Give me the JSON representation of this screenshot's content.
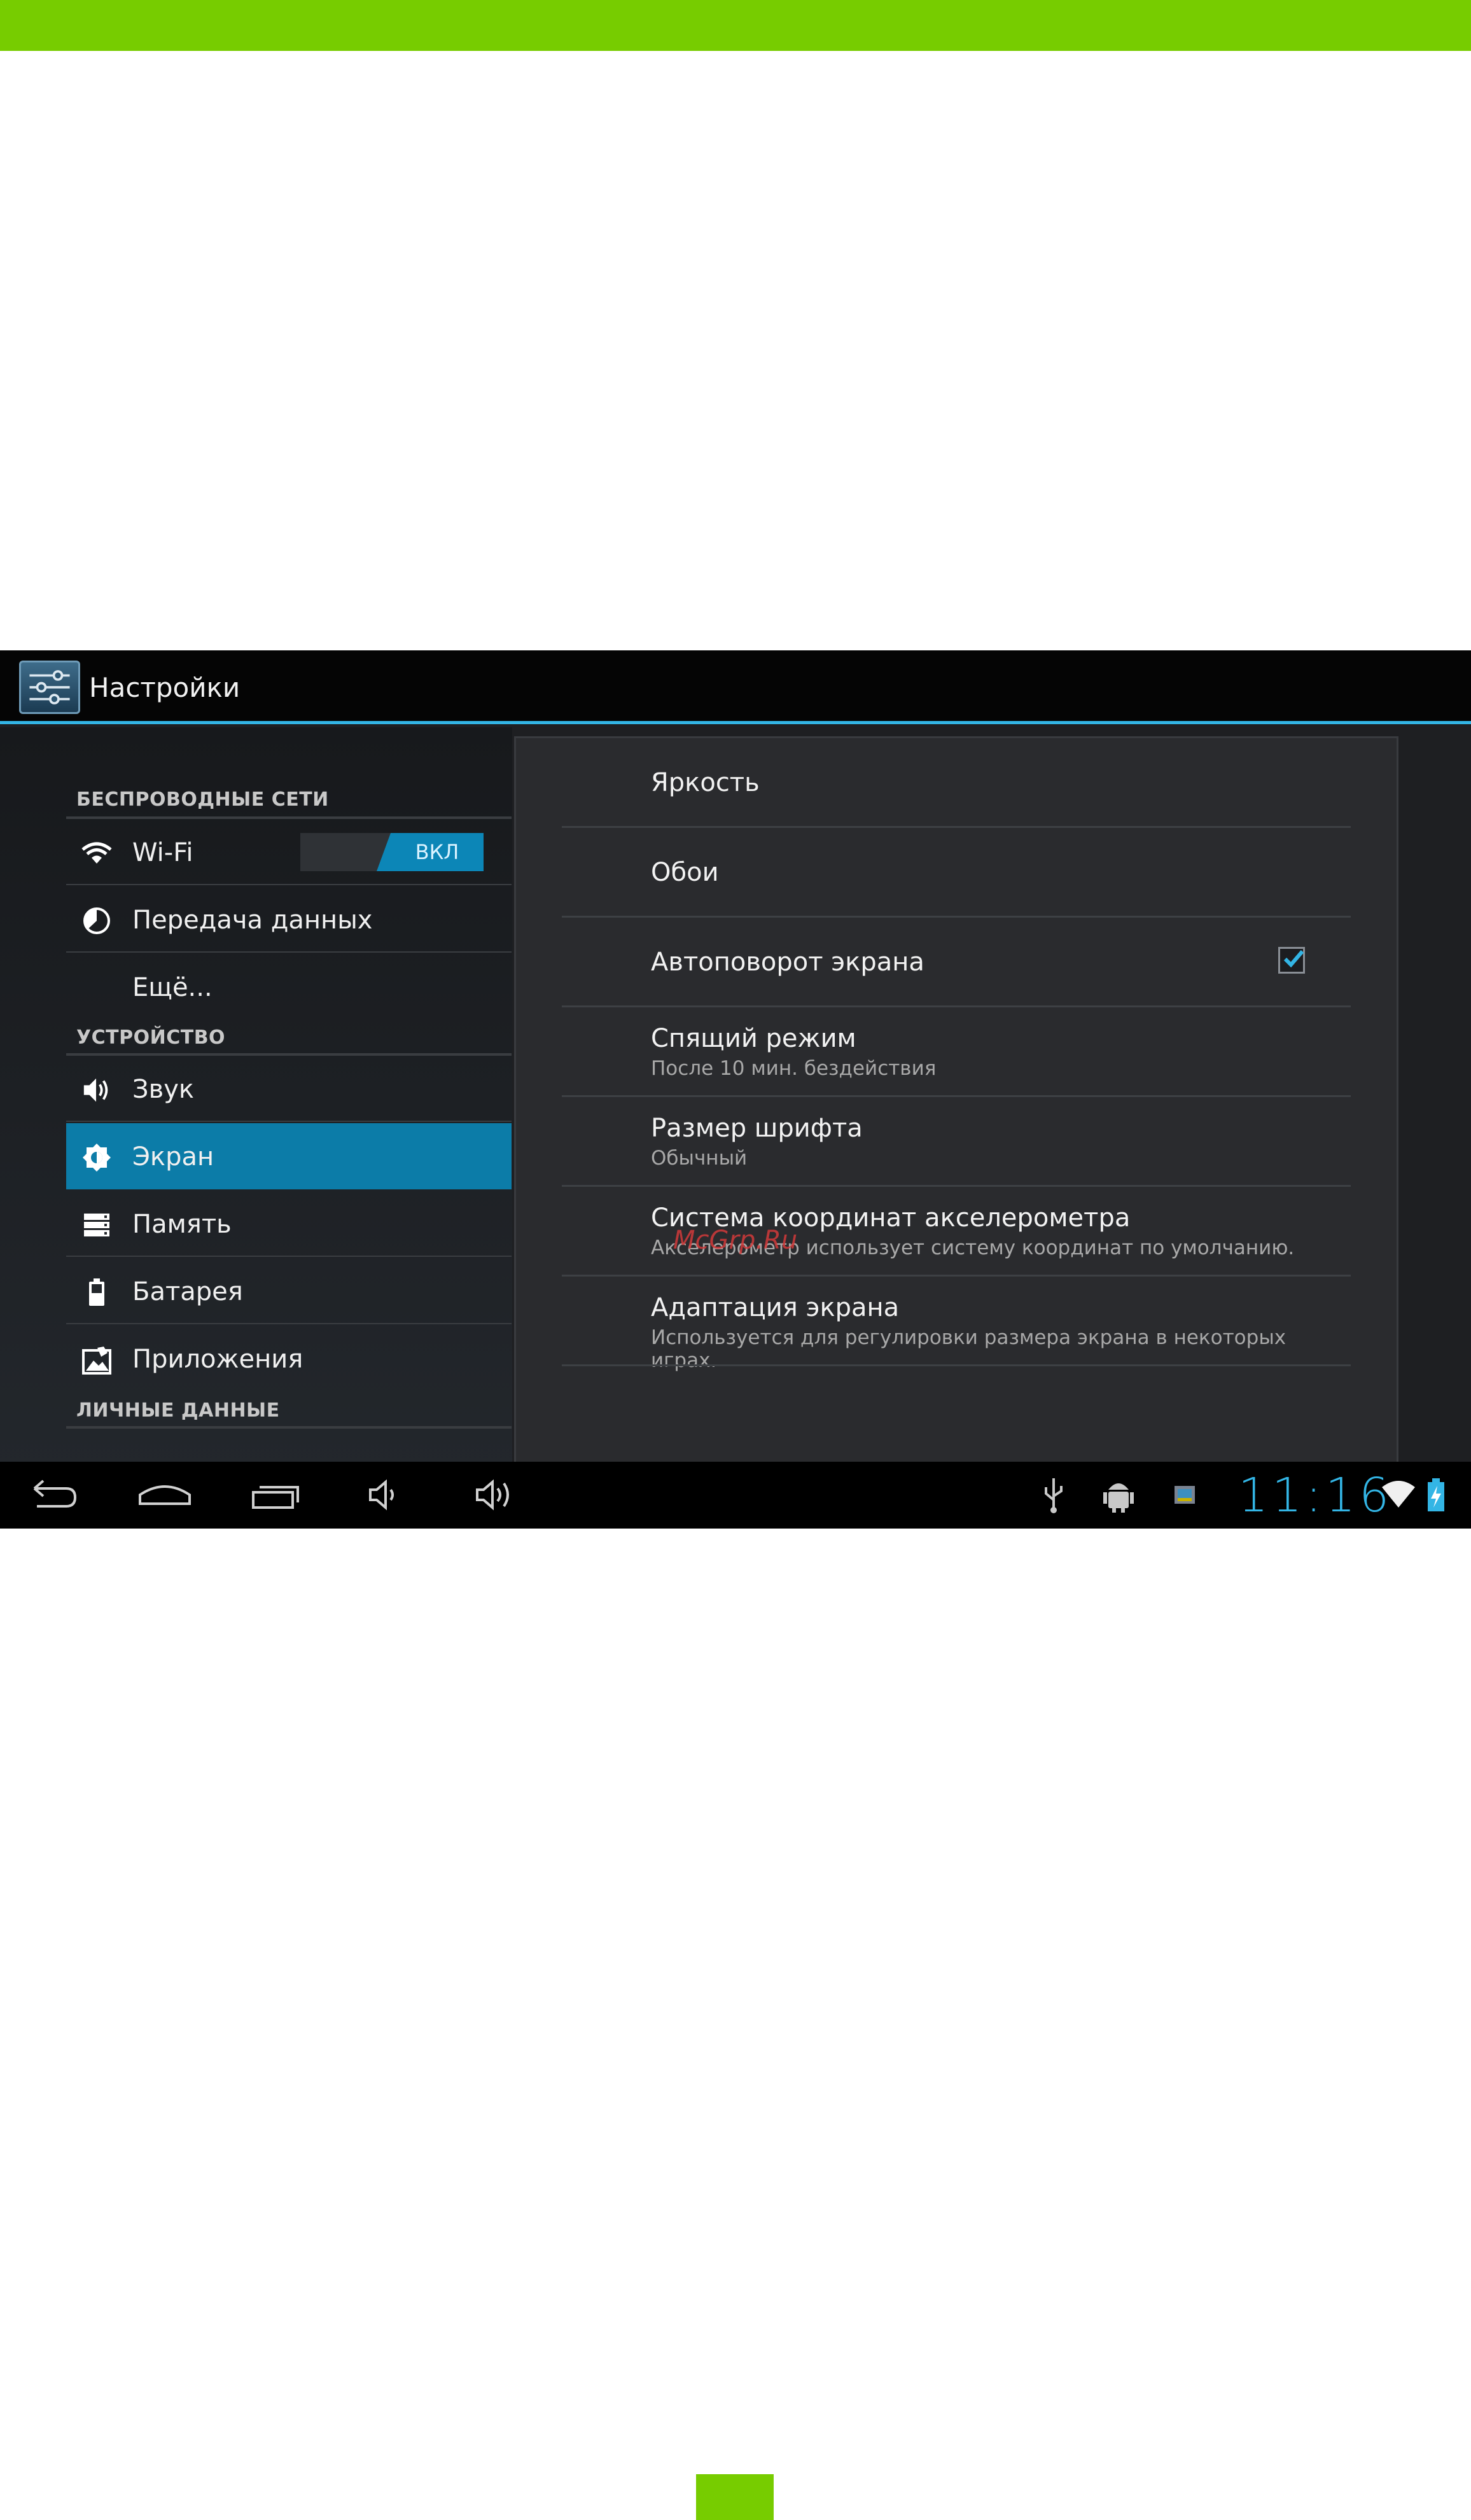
{
  "app": {
    "title": "Настройки",
    "icon": "settings-sliders-icon"
  },
  "sidebar": {
    "categories": [
      {
        "header": "БЕСПРОВОДНЫЕ СЕТИ"
      },
      {
        "header": "УСТРОЙСТВО"
      },
      {
        "header": "ЛИЧНЫЕ ДАННЫЕ"
      }
    ],
    "items": [
      {
        "label": "Wi-Fi",
        "icon": "wifi-icon",
        "toggle": "ВКЛ"
      },
      {
        "label": "Передача данных",
        "icon": "data-usage-icon"
      },
      {
        "label": "Ещё..."
      },
      {
        "label": "Звук",
        "icon": "speaker-icon"
      },
      {
        "label": "Экран",
        "icon": "brightness-icon",
        "selected": true
      },
      {
        "label": "Память",
        "icon": "storage-icon"
      },
      {
        "label": "Батарея",
        "icon": "battery-icon"
      },
      {
        "label": "Приложения",
        "icon": "apps-icon"
      }
    ]
  },
  "display_settings": {
    "items": [
      {
        "title": "Яркость"
      },
      {
        "title": "Обои"
      },
      {
        "title": "Автоповорот экрана",
        "checked": true
      },
      {
        "title": "Спящий режим",
        "summary": "После 10 мин. бездействия"
      },
      {
        "title": "Размер шрифта",
        "summary": "Обычный"
      },
      {
        "title": "Система координат акселерометра",
        "summary": "Акселерометр использует систему координат по умолчанию."
      },
      {
        "title": "Адаптация экрана",
        "summary": "Используется для регулировки размера экрана в некоторых играх."
      }
    ]
  },
  "status_bar": {
    "time": "11:16",
    "icons": [
      "usb-icon",
      "android-debug-icon",
      "screenshot-icon",
      "wifi-signal-icon",
      "battery-charging-icon"
    ]
  },
  "navigation": {
    "buttons": [
      "back-button",
      "home-button",
      "recent-apps-button",
      "volume-down-button",
      "volume-up-button"
    ]
  },
  "watermark": "McGrp.Ru",
  "colors": {
    "accent": "#33b5e5",
    "selected": "#0c7ca8",
    "page_band": "#77cc00"
  }
}
